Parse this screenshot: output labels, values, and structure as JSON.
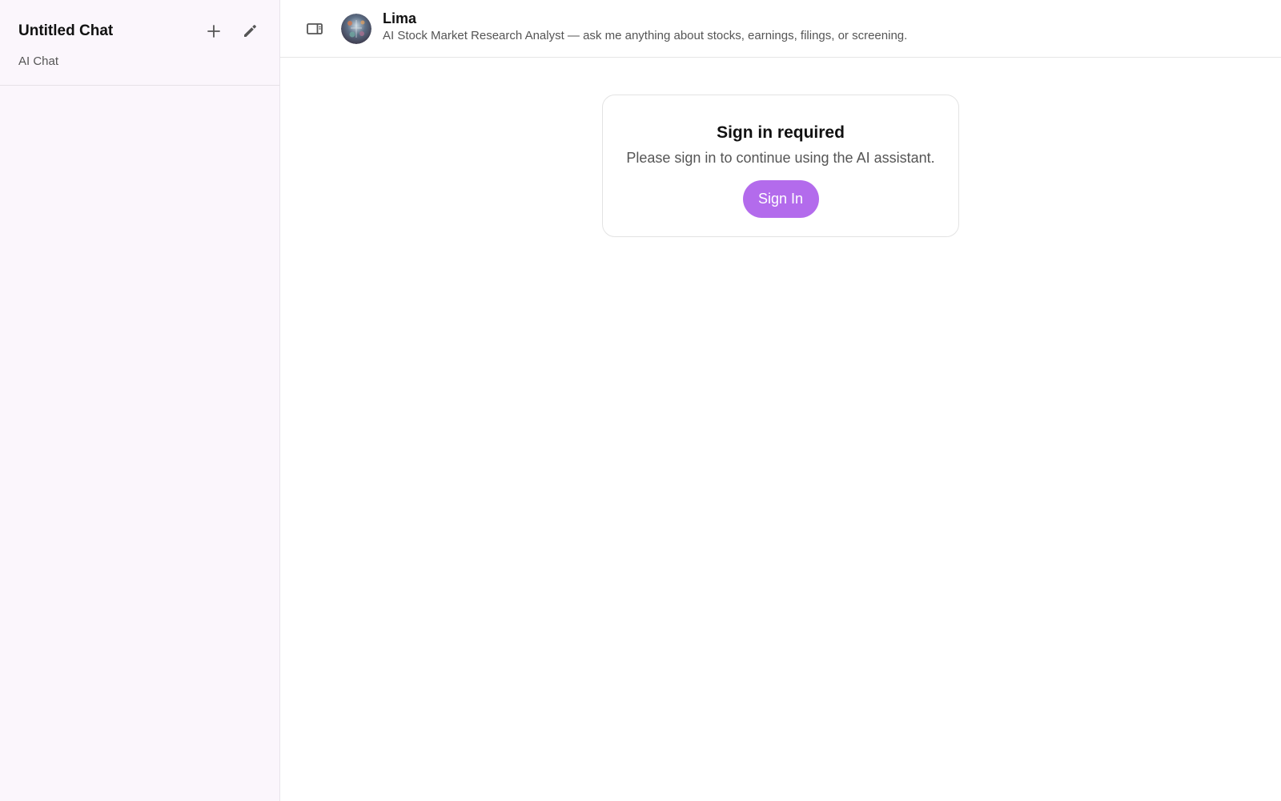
{
  "sidebar": {
    "title": "Untitled Chat",
    "subtitle": "AI Chat",
    "actions": [
      {
        "name": "new-chat",
        "icon": "plus-icon"
      },
      {
        "name": "edit",
        "icon": "pencil-icon"
      }
    ]
  },
  "header": {
    "toggle_icon": "sidebar-toggle-icon",
    "agent_name": "Lima",
    "agent_description": "AI Stock Market Research Analyst — ask me anything about stocks, earnings, filings, or screening."
  },
  "signin": {
    "title": "Sign in required",
    "message": "Please sign in to continue using the AI assistant.",
    "button_label": "Sign In",
    "button_color": "#b36bec"
  },
  "colors": {
    "sidebar_bg": "#fbf6fc",
    "accent": "#b36bec"
  }
}
